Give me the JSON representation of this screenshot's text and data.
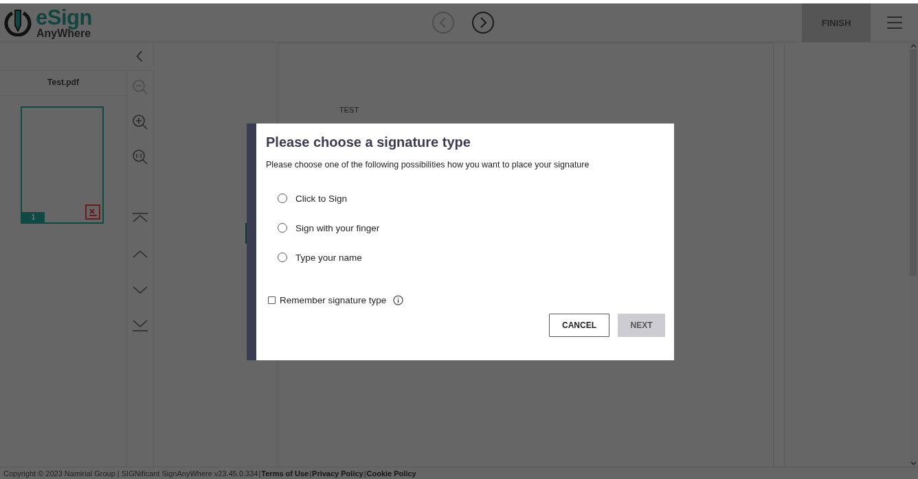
{
  "header": {
    "logo": {
      "primary": "eSign",
      "secondary": "AnyWhere"
    },
    "nav": [
      {
        "kind": "previous",
        "disabled": true
      },
      {
        "kind": "next",
        "disabled": false
      }
    ],
    "finish_button": "FINISH"
  },
  "sidebar": {
    "document": "Test.pdf",
    "thumbnails": [
      {
        "page": "1",
        "selected": true
      }
    ]
  },
  "tools": [
    {
      "kind": "zoom-out",
      "disabled": true
    },
    {
      "kind": "zoom-in",
      "disabled": false
    },
    {
      "kind": "zoom-actual",
      "disabled": false
    },
    {
      "kind": "first",
      "disabled": false
    },
    {
      "kind": "previous",
      "disabled": false
    },
    {
      "kind": "next",
      "disabled": false
    },
    {
      "kind": "last",
      "disabled": false
    }
  ],
  "document": {
    "text": "TEST"
  },
  "dialog": {
    "title": "Please choose a signature type",
    "description": "Please choose one of the following possibilities how you want to place your signature",
    "options": [
      {
        "label": "Click to Sign",
        "selected": false
      },
      {
        "label": "Sign with your finger",
        "selected": false
      },
      {
        "label": "Type your name",
        "selected": false
      }
    ],
    "remember": {
      "label": "Remember signature type",
      "checked": false
    },
    "buttons": [
      {
        "label": "CANCEL",
        "kind": "secondary"
      },
      {
        "label": "NEXT",
        "kind": "primary"
      }
    ]
  },
  "footer": [
    {
      "kind": "text",
      "text": "Copyright © 2023 Namirial Group | SIGNificant SignAnyWhere v23.45.0.334"
    },
    {
      "kind": "separator",
      "text": "|"
    },
    {
      "kind": "link",
      "text": "Terms of Use"
    },
    {
      "kind": "separator",
      "text": "|"
    },
    {
      "kind": "link",
      "text": "Privacy Policy"
    },
    {
      "kind": "separator",
      "text": "|"
    },
    {
      "kind": "link",
      "text": "Cookie Policy"
    }
  ]
}
